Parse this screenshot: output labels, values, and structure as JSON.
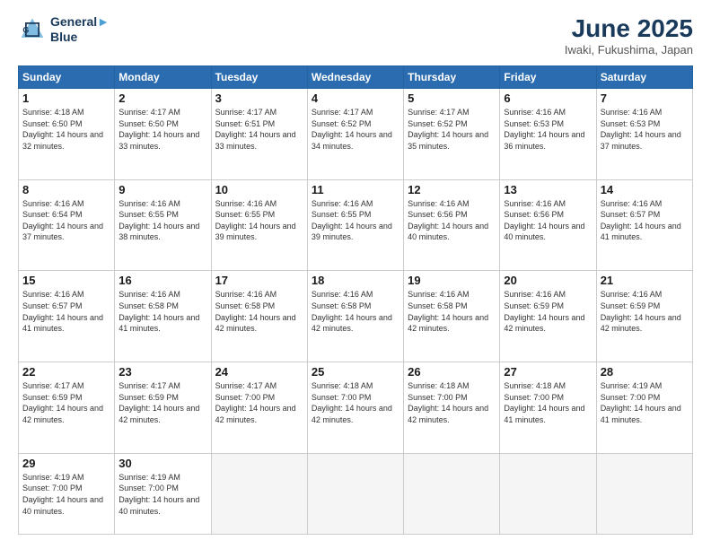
{
  "logo": {
    "line1": "General",
    "line2": "Blue"
  },
  "title": "June 2025",
  "subtitle": "Iwaki, Fukushima, Japan",
  "days_of_week": [
    "Sunday",
    "Monday",
    "Tuesday",
    "Wednesday",
    "Thursday",
    "Friday",
    "Saturday"
  ],
  "weeks": [
    [
      {
        "num": "1",
        "sunrise": "4:18 AM",
        "sunset": "6:50 PM",
        "daylight": "14 hours and 32 minutes."
      },
      {
        "num": "2",
        "sunrise": "4:17 AM",
        "sunset": "6:50 PM",
        "daylight": "14 hours and 33 minutes."
      },
      {
        "num": "3",
        "sunrise": "4:17 AM",
        "sunset": "6:51 PM",
        "daylight": "14 hours and 33 minutes."
      },
      {
        "num": "4",
        "sunrise": "4:17 AM",
        "sunset": "6:52 PM",
        "daylight": "14 hours and 34 minutes."
      },
      {
        "num": "5",
        "sunrise": "4:17 AM",
        "sunset": "6:52 PM",
        "daylight": "14 hours and 35 minutes."
      },
      {
        "num": "6",
        "sunrise": "4:16 AM",
        "sunset": "6:53 PM",
        "daylight": "14 hours and 36 minutes."
      },
      {
        "num": "7",
        "sunrise": "4:16 AM",
        "sunset": "6:53 PM",
        "daylight": "14 hours and 37 minutes."
      }
    ],
    [
      {
        "num": "8",
        "sunrise": "4:16 AM",
        "sunset": "6:54 PM",
        "daylight": "14 hours and 37 minutes."
      },
      {
        "num": "9",
        "sunrise": "4:16 AM",
        "sunset": "6:55 PM",
        "daylight": "14 hours and 38 minutes."
      },
      {
        "num": "10",
        "sunrise": "4:16 AM",
        "sunset": "6:55 PM",
        "daylight": "14 hours and 39 minutes."
      },
      {
        "num": "11",
        "sunrise": "4:16 AM",
        "sunset": "6:55 PM",
        "daylight": "14 hours and 39 minutes."
      },
      {
        "num": "12",
        "sunrise": "4:16 AM",
        "sunset": "6:56 PM",
        "daylight": "14 hours and 40 minutes."
      },
      {
        "num": "13",
        "sunrise": "4:16 AM",
        "sunset": "6:56 PM",
        "daylight": "14 hours and 40 minutes."
      },
      {
        "num": "14",
        "sunrise": "4:16 AM",
        "sunset": "6:57 PM",
        "daylight": "14 hours and 41 minutes."
      }
    ],
    [
      {
        "num": "15",
        "sunrise": "4:16 AM",
        "sunset": "6:57 PM",
        "daylight": "14 hours and 41 minutes."
      },
      {
        "num": "16",
        "sunrise": "4:16 AM",
        "sunset": "6:58 PM",
        "daylight": "14 hours and 41 minutes."
      },
      {
        "num": "17",
        "sunrise": "4:16 AM",
        "sunset": "6:58 PM",
        "daylight": "14 hours and 42 minutes."
      },
      {
        "num": "18",
        "sunrise": "4:16 AM",
        "sunset": "6:58 PM",
        "daylight": "14 hours and 42 minutes."
      },
      {
        "num": "19",
        "sunrise": "4:16 AM",
        "sunset": "6:58 PM",
        "daylight": "14 hours and 42 minutes."
      },
      {
        "num": "20",
        "sunrise": "4:16 AM",
        "sunset": "6:59 PM",
        "daylight": "14 hours and 42 minutes."
      },
      {
        "num": "21",
        "sunrise": "4:16 AM",
        "sunset": "6:59 PM",
        "daylight": "14 hours and 42 minutes."
      }
    ],
    [
      {
        "num": "22",
        "sunrise": "4:17 AM",
        "sunset": "6:59 PM",
        "daylight": "14 hours and 42 minutes."
      },
      {
        "num": "23",
        "sunrise": "4:17 AM",
        "sunset": "6:59 PM",
        "daylight": "14 hours and 42 minutes."
      },
      {
        "num": "24",
        "sunrise": "4:17 AM",
        "sunset": "7:00 PM",
        "daylight": "14 hours and 42 minutes."
      },
      {
        "num": "25",
        "sunrise": "4:18 AM",
        "sunset": "7:00 PM",
        "daylight": "14 hours and 42 minutes."
      },
      {
        "num": "26",
        "sunrise": "4:18 AM",
        "sunset": "7:00 PM",
        "daylight": "14 hours and 42 minutes."
      },
      {
        "num": "27",
        "sunrise": "4:18 AM",
        "sunset": "7:00 PM",
        "daylight": "14 hours and 41 minutes."
      },
      {
        "num": "28",
        "sunrise": "4:19 AM",
        "sunset": "7:00 PM",
        "daylight": "14 hours and 41 minutes."
      }
    ],
    [
      {
        "num": "29",
        "sunrise": "4:19 AM",
        "sunset": "7:00 PM",
        "daylight": "14 hours and 40 minutes."
      },
      {
        "num": "30",
        "sunrise": "4:19 AM",
        "sunset": "7:00 PM",
        "daylight": "14 hours and 40 minutes."
      },
      null,
      null,
      null,
      null,
      null
    ]
  ]
}
